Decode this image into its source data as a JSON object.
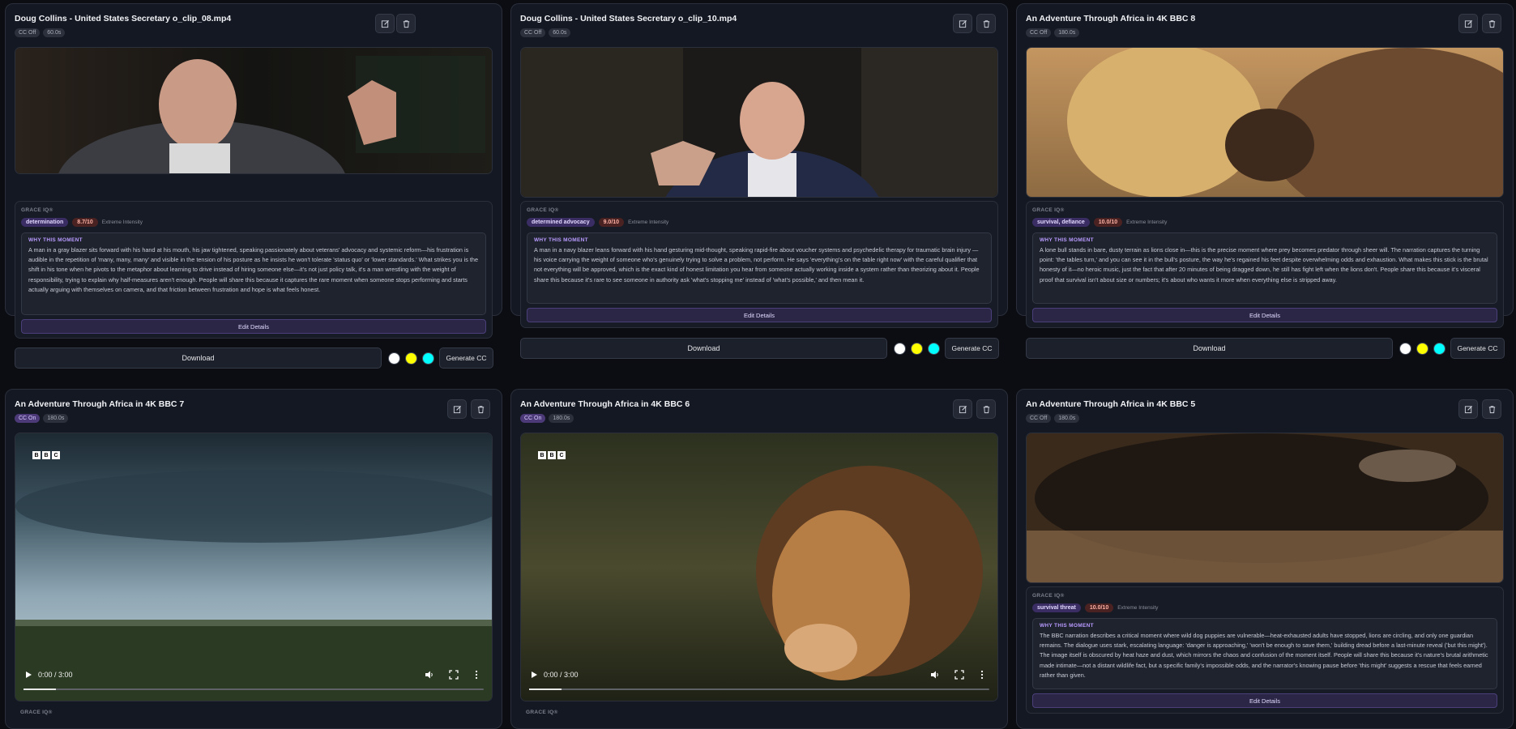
{
  "cards": [
    {
      "title": "Doug Collins - United States Secretary o_clip_08.mp4",
      "cc": "CC Off",
      "duration": "60.0s",
      "grace_label": "GRACE IQ®",
      "emotion": "determination",
      "score": "8.7/10",
      "intensity": "Extreme Intensity",
      "why_label": "WHY THIS MOMENT",
      "why_text": "A man in a gray blazer sits forward with his hand at his mouth, his jaw tightened, speaking passionately about veterans' advocacy and systemic reform—his frustration is audible in the repetition of 'many, many, many' and visible in the tension of his posture as he insists he won't tolerate 'status quo' or 'lower standards.' What strikes you is the shift in his tone when he pivots to the metaphor about learning to drive instead of hiring someone else—it's not just policy talk, it's a man wrestling with the weight of responsibility, trying to explain why half-measures aren't enough. People will share this because it captures the rare moment when someone stops performing and starts actually arguing with themselves on camera, and that friction between frustration and hope is what feels honest.",
      "edit_details": "Edit Details",
      "download": "Download",
      "generate_cc": "Generate CC"
    },
    {
      "title": "Doug Collins - United States Secretary o_clip_10.mp4",
      "cc": "CC Off",
      "duration": "60.0s",
      "grace_label": "GRACE IQ®",
      "emotion": "determined advocacy",
      "score": "9.0/10",
      "intensity": "Extreme Intensity",
      "why_label": "WHY THIS MOMENT",
      "why_text": "A man in a navy blazer leans forward with his hand gesturing mid-thought, speaking rapid-fire about voucher systems and psychedelic therapy for traumatic brain injury — his voice carrying the weight of someone who's genuinely trying to solve a problem, not perform. He says 'everything's on the table right now' with the careful qualifier that not everything will be approved, which is the exact kind of honest limitation you hear from someone actually working inside a system rather than theorizing about it. People share this because it's rare to see someone in authority ask 'what's stopping me' instead of 'what's possible,' and then mean it.",
      "edit_details": "Edit Details",
      "download": "Download",
      "generate_cc": "Generate CC"
    },
    {
      "title": "An Adventure Through Africa in 4K BBC 8",
      "cc": "CC Off",
      "duration": "180.0s",
      "grace_label": "GRACE IQ®",
      "emotion": "survival, defiance",
      "score": "10.0/10",
      "intensity": "Extreme Intensity",
      "why_label": "WHY THIS MOMENT",
      "why_text": "A lone bull stands in bare, dusty terrain as lions close in—this is the precise moment where prey becomes predator through sheer will. The narration captures the turning point: 'the tables turn,' and you can see it in the bull's posture, the way he's regained his feet despite overwhelming odds and exhaustion. What makes this stick is the brutal honesty of it—no heroic music, just the fact that after 20 minutes of being dragged down, he still has fight left when the lions don't. People share this because it's visceral proof that survival isn't about size or numbers; it's about who wants it more when everything else is stripped away.",
      "edit_details": "Edit Details",
      "download": "Download",
      "generate_cc": "Generate CC"
    },
    {
      "title": "An Adventure Through Africa in 4K BBC 7",
      "cc": "CC On",
      "duration": "180.0s",
      "time": "0:00 / 3:00",
      "grace_label": "GRACE IQ®",
      "progress": 0.07
    },
    {
      "title": "An Adventure Through Africa in 4K BBC 6",
      "cc": "CC On",
      "duration": "180.0s",
      "time": "0:00 / 3:00",
      "grace_label": "GRACE IQ®",
      "progress": 0.07
    },
    {
      "title": "An Adventure Through Africa in 4K BBC 5",
      "cc": "CC Off",
      "duration": "180.0s",
      "grace_label": "GRACE IQ®",
      "emotion": "survival threat",
      "score": "10.0/10",
      "intensity": "Extreme Intensity",
      "why_label": "WHY THIS MOMENT",
      "why_text": "The BBC narration describes a critical moment where wild dog puppies are vulnerable—heat-exhausted adults have stopped, lions are circling, and only one guardian remains. The dialogue uses stark, escalating language: 'danger is approaching,' 'won't be enough to save them,' building dread before a last-minute reveal ('but this might'). The image itself is obscured by heat haze and dust, which mirrors the chaos and confusion of the moment itself. People will share this because it's nature's brutal arithmetic made intimate—not a distant wildlife fact, but a specific family's impossible odds, and the narrator's knowing pause before 'this might' suggests a rescue that feels earned rather than given.",
      "edit_details": "Edit Details"
    }
  ],
  "bbc_logo": [
    "B",
    "B",
    "C"
  ],
  "swatch_colors": [
    "#ffffff",
    "#ffff00",
    "#00ffff"
  ],
  "icons": {
    "edit": "edit-icon",
    "delete": "trash-icon"
  }
}
